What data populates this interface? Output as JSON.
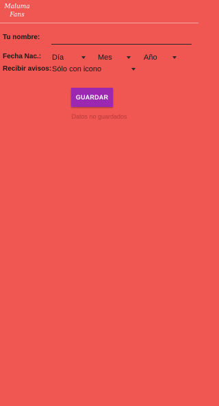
{
  "app": {
    "title": "Maluma\nFans"
  },
  "form": {
    "name_label": "Tu nombre:",
    "name_value": "",
    "birth_label": "Fecha Nac.:",
    "day": {
      "selected": "Día"
    },
    "month": {
      "selected": "Mes"
    },
    "year": {
      "selected": "Año"
    },
    "notify_label": "Recibir avisos:",
    "notify": {
      "selected": "Sólo con icono"
    },
    "save_label": "GUARDAR",
    "status_text": "Datos no guardados"
  },
  "colors": {
    "background": "#f05652",
    "button": "#9c27b0",
    "button_text": "#ffffff"
  },
  "icons": [
    "dropdown-caret-icon"
  ]
}
